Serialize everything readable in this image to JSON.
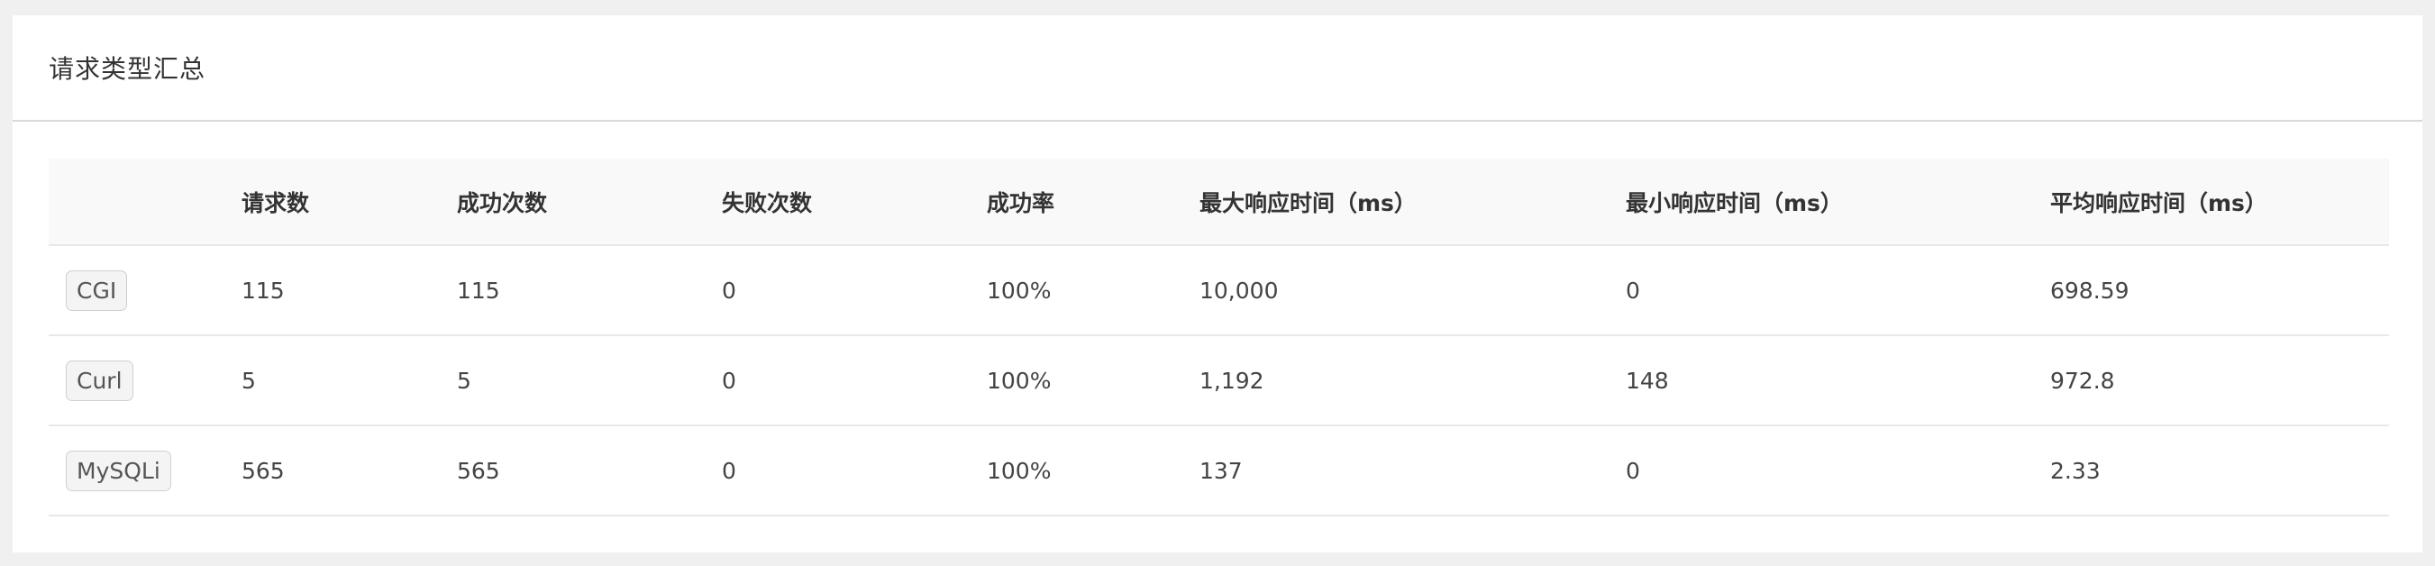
{
  "panel": {
    "title": "请求类型汇总"
  },
  "table": {
    "columns": [
      "",
      "请求数",
      "成功次数",
      "失败次数",
      "成功率",
      "最大响应时间（ms）",
      "最小响应时间（ms）",
      "平均响应时间（ms）"
    ],
    "rows": [
      {
        "type": "CGI",
        "requests": "115",
        "success": "115",
        "failures": "0",
        "success_rate": "100%",
        "max_ms": "10,000",
        "min_ms": "0",
        "avg_ms": "698.59"
      },
      {
        "type": "Curl",
        "requests": "5",
        "success": "5",
        "failures": "0",
        "success_rate": "100%",
        "max_ms": "1,192",
        "min_ms": "148",
        "avg_ms": "972.8"
      },
      {
        "type": "MySQLi",
        "requests": "565",
        "success": "565",
        "failures": "0",
        "success_rate": "100%",
        "max_ms": "137",
        "min_ms": "0",
        "avg_ms": "2.33"
      }
    ]
  }
}
